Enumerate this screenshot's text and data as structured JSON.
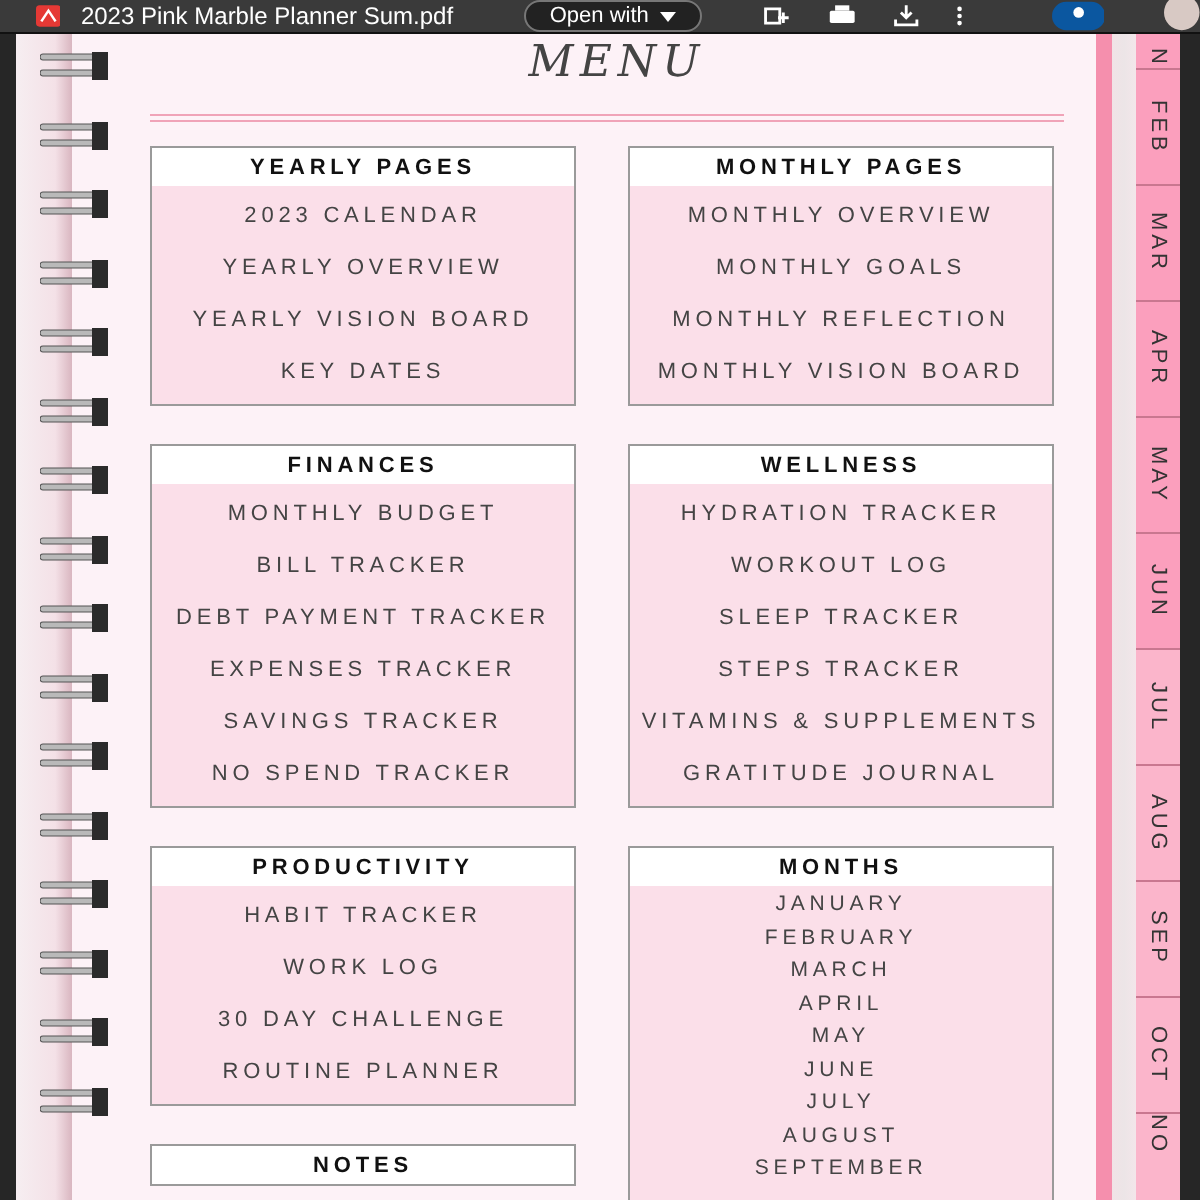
{
  "toolbar": {
    "title": "2023 Pink Marble Planner Sum.pdf",
    "open_with": "Open with"
  },
  "page": {
    "title": "MENU",
    "columns": [
      [
        {
          "title": "YEARLY PAGES",
          "kind": "menu",
          "items": [
            "2023 CALENDAR",
            "YEARLY OVERVIEW",
            "YEARLY VISION BOARD",
            "KEY DATES"
          ]
        },
        {
          "title": "FINANCES",
          "kind": "menu",
          "items": [
            "MONTHLY BUDGET",
            "BILL TRACKER",
            "DEBT PAYMENT TRACKER",
            "EXPENSES TRACKER",
            "SAVINGS TRACKER",
            "NO SPEND TRACKER"
          ]
        },
        {
          "title": "PRODUCTIVITY",
          "kind": "menu",
          "items": [
            "HABIT TRACKER",
            "WORK LOG",
            "30 DAY CHALLENGE",
            "ROUTINE PLANNER"
          ]
        },
        {
          "title": "NOTES",
          "kind": "menu"
        }
      ],
      [
        {
          "title": "MONTHLY PAGES",
          "kind": "menu",
          "items": [
            "MONTHLY OVERVIEW",
            "MONTHLY GOALS",
            "MONTHLY REFLECTION",
            "MONTHLY VISION BOARD"
          ]
        },
        {
          "title": "WELLNESS",
          "kind": "menu",
          "items": [
            "HYDRATION TRACKER",
            "WORKOUT LOG",
            "SLEEP TRACKER",
            "STEPS TRACKER",
            "VITAMINS & SUPPLEMENTS",
            "GRATITUDE JOURNAL"
          ]
        },
        {
          "title": "MONTHS",
          "kind": "list",
          "items": [
            "JANUARY",
            "FEBRUARY",
            "MARCH",
            "APRIL",
            "MAY",
            "JUNE",
            "JULY",
            "AUGUST",
            "SEPTEMBER"
          ]
        }
      ]
    ]
  },
  "tabs": [
    "N",
    "FEB",
    "MAR",
    "APR",
    "MAY",
    "JUN",
    "JUL",
    "AUG",
    "SEP",
    "OCT",
    "NO"
  ]
}
